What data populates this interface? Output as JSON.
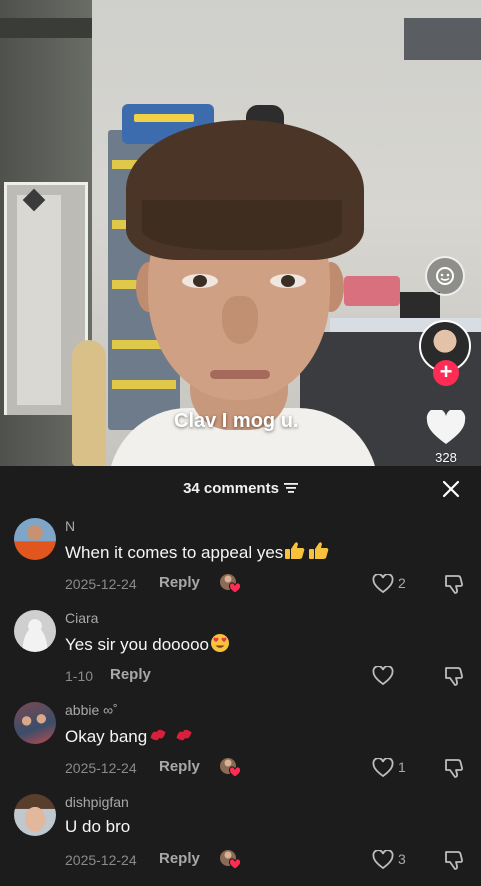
{
  "video": {
    "caption": "Clav I mog u.",
    "like_count": "328"
  },
  "comments_sheet": {
    "title": "34 comments",
    "comments": [
      {
        "user": "N",
        "text": "When it comes to appeal yes",
        "date": "2025-12-24",
        "reply": "Reply",
        "likes": "2"
      },
      {
        "user": "Ciara",
        "text": "Yes sir you dooooo",
        "date": "1-10",
        "reply": "Reply",
        "likes": ""
      },
      {
        "user": "abbie ∞˚",
        "text": "Okay bang",
        "date": "2025-12-24",
        "reply": "Reply",
        "likes": "1"
      },
      {
        "user": "dishpigfan",
        "text": "U do bro",
        "date": "2025-12-24",
        "reply": "Reply",
        "likes": "3"
      }
    ]
  },
  "colors": {
    "sheet_bg": "#1c1c1c",
    "accent": "#fe2c55",
    "secondary_text": "#a8a8a8"
  },
  "icons": [
    "chat-bubble-icon",
    "plus-icon",
    "heart-icon",
    "sort-icon",
    "close-icon",
    "thumbs-up-emoji",
    "heart-eyes-emoji",
    "kiss-mark-emoji",
    "creator-liked-icon",
    "dislike-icon"
  ]
}
